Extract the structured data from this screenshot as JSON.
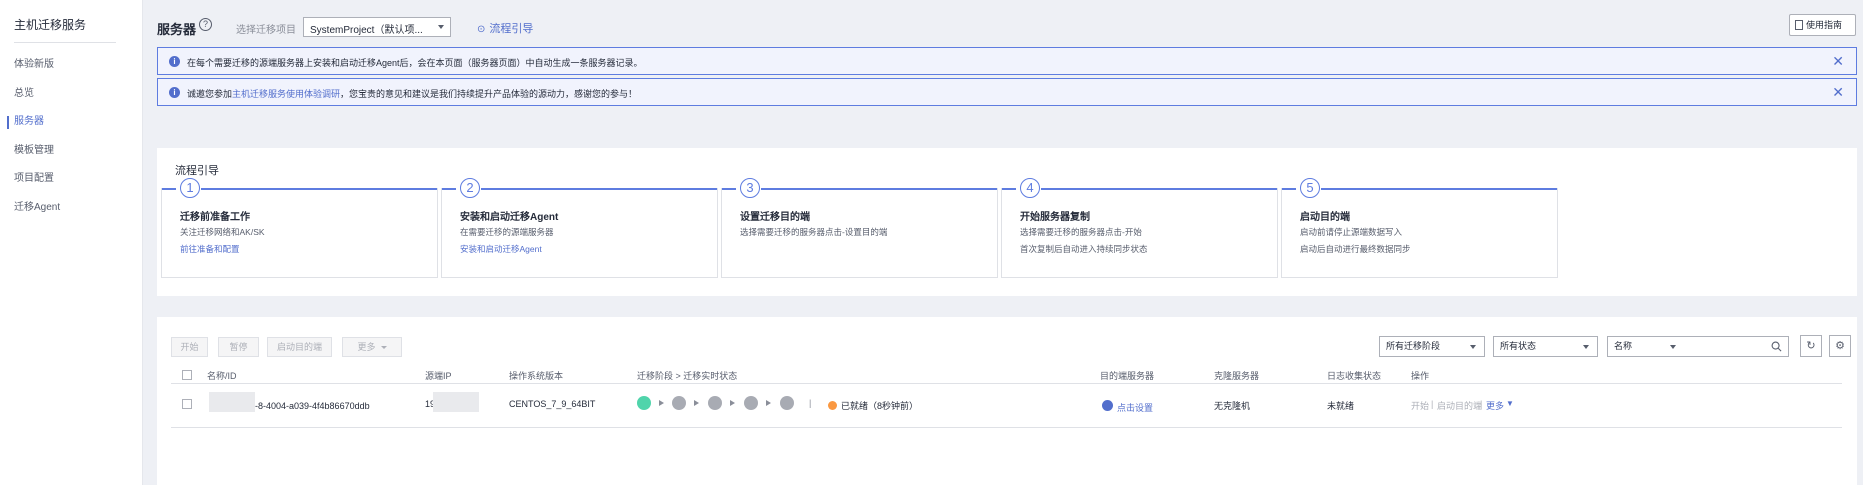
{
  "sidebar": {
    "title": "主机迁移服务",
    "items": [
      {
        "label": "体验新版"
      },
      {
        "label": "总览"
      },
      {
        "label": "服务器"
      },
      {
        "label": "模板管理"
      },
      {
        "label": "项目配置"
      },
      {
        "label": "迁移Agent"
      }
    ],
    "active_index": 2
  },
  "header": {
    "title": "服务器",
    "help_glyph": "?",
    "project_label": "选择迁移项目",
    "project_value": "SystemProject（默认项...",
    "guide_link": "流程引导",
    "usage_button": "使用指南"
  },
  "alerts": [
    {
      "text": "在每个需要迁移的源端服务器上安装和启动迁移Agent后，会在本页面（服务器页面）中自动生成一条服务器记录。"
    },
    {
      "text_before": "诚邀您参加",
      "link": "主机迁移服务使用体验调研",
      "text_after": "，您宝贵的意见和建议是我们持续提升产品体验的源动力，感谢您的参与！"
    }
  ],
  "flow": {
    "title": "流程引导",
    "steps": [
      {
        "num": "1",
        "title": "迁移前准备工作",
        "line1": "关注迁移网络和AK/SK",
        "line2": "前往准备和配置",
        "line2_link": true
      },
      {
        "num": "2",
        "title": "安装和启动迁移Agent",
        "line1": "在需要迁移的源端服务器",
        "line2": "安装和启动迁移Agent",
        "line2_link": true
      },
      {
        "num": "3",
        "title": "设置迁移目的端",
        "line1": "选择需要迁移的服务器点击-设置目的端",
        "line2": "",
        "line2_link": false
      },
      {
        "num": "4",
        "title": "开始服务器复制",
        "line1": "选择需要迁移的服务器点击-开始",
        "line2": "首次复制后自动进入持续同步状态",
        "line2_link": false
      },
      {
        "num": "5",
        "title": "启动目的端",
        "line1": "启动前请停止源端数据写入",
        "line2": "启动后自动进行最终数据同步",
        "line2_link": false
      }
    ]
  },
  "toolbar": {
    "start": "开始",
    "pause": "暂停",
    "launch_target": "启动目的端",
    "more": "更多",
    "stage_filter": "所有迁移阶段",
    "status_filter": "所有状态",
    "search_field": "名称",
    "refresh_glyph": "↻",
    "settings_glyph": "⚙"
  },
  "table": {
    "headers": {
      "name": "名称/ID",
      "source_ip": "源端IP",
      "os": "操作系统版本",
      "stage": "迁移阶段 > 迁移实时状态",
      "target": "目的端服务器",
      "clone": "克隆服务器",
      "log": "日志收集状态",
      "actions": "操作"
    },
    "rows": [
      {
        "name_suffix": "-8-4004-a039-4f4b86670ddb",
        "ip_prefix": "19",
        "os": "CENTOS_7_9_64BIT",
        "status": "已就绪（8秒钟前）",
        "target": "点击设置",
        "clone": "无克隆机",
        "log": "未就绪",
        "action_start": "开始",
        "action_launch": "启动目的端",
        "action_more": "更多"
      }
    ]
  },
  "colors": {
    "accent": "#526ecc",
    "success": "#50d4ab",
    "warning": "#fa9841"
  }
}
